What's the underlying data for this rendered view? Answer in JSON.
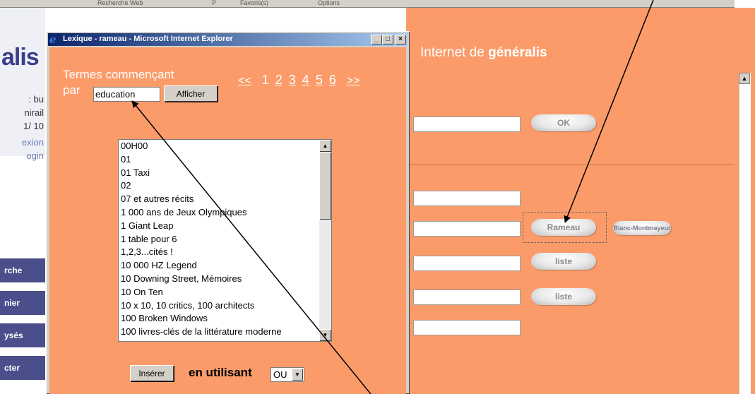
{
  "background": {
    "toolbar_items": [
      "Recherche Web",
      "P",
      "Favoris(s)",
      "Options"
    ],
    "site_logo_fragment": "alis",
    "left_texts": [
      ": bu",
      "nirail",
      "1/ 10",
      "exion",
      "ogin"
    ],
    "left_nav": [
      "rche",
      "nier",
      "ysés",
      "cter"
    ],
    "heading_prefix": "Internet de ",
    "heading_brand": "généralis",
    "buttons": {
      "ok": "OK",
      "rameau": "Rameau",
      "blanc": "Blanc-Montmayeur",
      "liste1": "liste",
      "liste2": "liste"
    }
  },
  "popup": {
    "title": "Lexique - rameau - Microsoft Internet Explorer",
    "label_line1": "Termes commençant",
    "label_line2": "par",
    "search_value": "education",
    "show_button": "Afficher",
    "pager": {
      "prev": "<<",
      "current": "1",
      "pages": [
        "2",
        "3",
        "4",
        "5",
        "6"
      ],
      "next": ">>"
    },
    "terms": [
      "00H00",
      "01",
      "01 Taxi",
      "02",
      "07 et autres récits",
      "1 000 ans de Jeux Olympiques",
      "1 Giant Leap",
      "1 table pour 6",
      "1,2,3...cités !",
      "10 000 HZ Legend",
      "10 Downing Street, Mémoires",
      "10 On Ten",
      "10 x 10, 10 critics, 100 architects",
      "100 Broken Windows",
      "100 livres-clés de la littérature moderne"
    ],
    "insert_button": "Insérer",
    "using_label": "en utilisant",
    "operator_value": "OU"
  },
  "colors": {
    "orange": "#fb9b6a",
    "titlebar": "#0a246a",
    "nav_blue": "#4a4f8c"
  },
  "icons": [
    "ie-logo-icon",
    "minimize-icon",
    "maximize-icon",
    "close-icon",
    "scroll-up-icon",
    "scroll-down-icon",
    "dropdown-arrow-icon",
    "annotation-arrow"
  ]
}
